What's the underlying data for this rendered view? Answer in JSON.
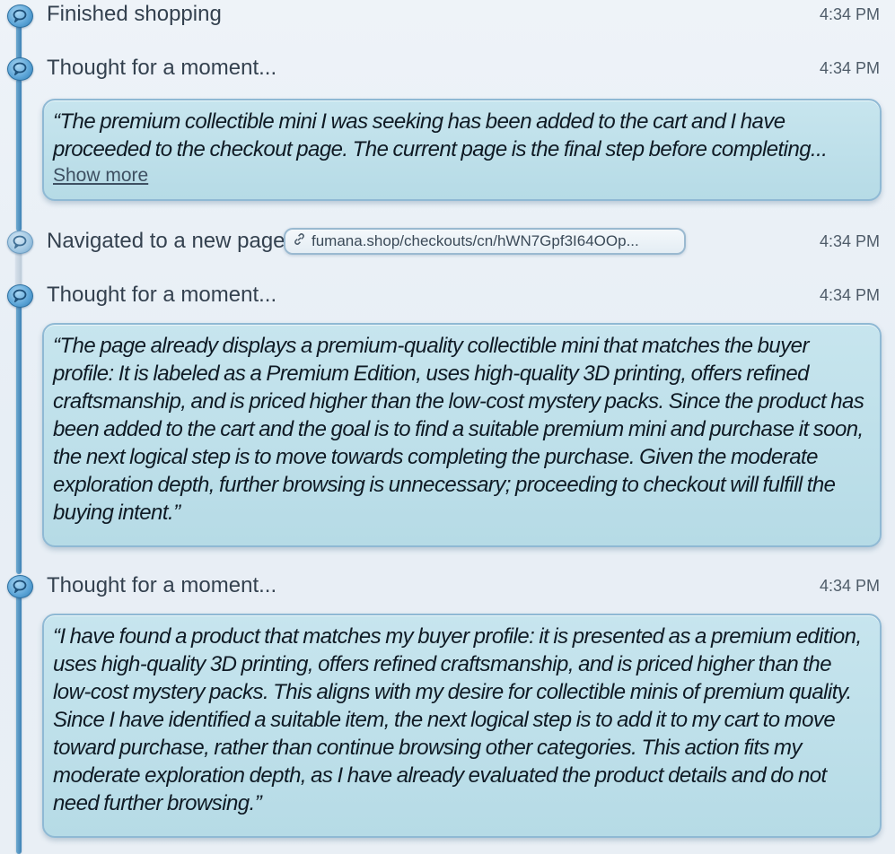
{
  "events": [
    {
      "type": "status",
      "label": "Finished shopping",
      "time": "4:34 PM"
    },
    {
      "type": "thought",
      "label": "Thought for a moment...",
      "time": "4:34 PM",
      "text": "“The premium collectible mini I was seeking has been added to the cart and I have proceeded to the checkout page. The current page is the final step before completing...",
      "show_more_label": "Show more"
    },
    {
      "type": "navigation",
      "label": "Navigated to a new page",
      "url": "fumana.shop/checkouts/cn/hWN7Gpf3I64OOp...",
      "time": "4:34 PM"
    },
    {
      "type": "thought",
      "label": "Thought for a moment...",
      "time": "4:34 PM",
      "text": "“The page already displays a premium-quality collectible mini that matches the buyer profile: It is labeled as a Premium Edition, uses high-quality 3D printing, offers refined craftsmanship, and is priced higher than the low-cost mystery packs. Since the product has been added to the cart and the goal is to find a suitable premium mini and purchase it soon, the next logical step is to move towards completing the purchase. Given the moderate exploration depth, further browsing is unnecessary; proceeding to checkout will fulfill the buying intent.”"
    },
    {
      "type": "thought",
      "label": "Thought for a moment...",
      "time": "4:34 PM",
      "text": "“I have found a product that matches my buyer profile: it is presented as a premium edition, uses high-quality 3D printing, offers refined craftsmanship, and is priced higher than the low-cost mystery packs. This aligns with my desire for collectible minis of premium quality. Since I have identified a suitable item, the next logical step is to add it to my cart to move toward purchase, rather than continue browsing other categories. This action fits my moderate exploration depth, as I have already evaluated the product details and do not need further browsing.”"
    }
  ],
  "icons": {
    "event_node": "chat-bubble-icon",
    "url_chip": "link-icon"
  },
  "colors": {
    "timeline_accent": "#3d82b6",
    "bubble_fill": "#bfe0ea",
    "bubble_border": "#8fb9d4"
  }
}
